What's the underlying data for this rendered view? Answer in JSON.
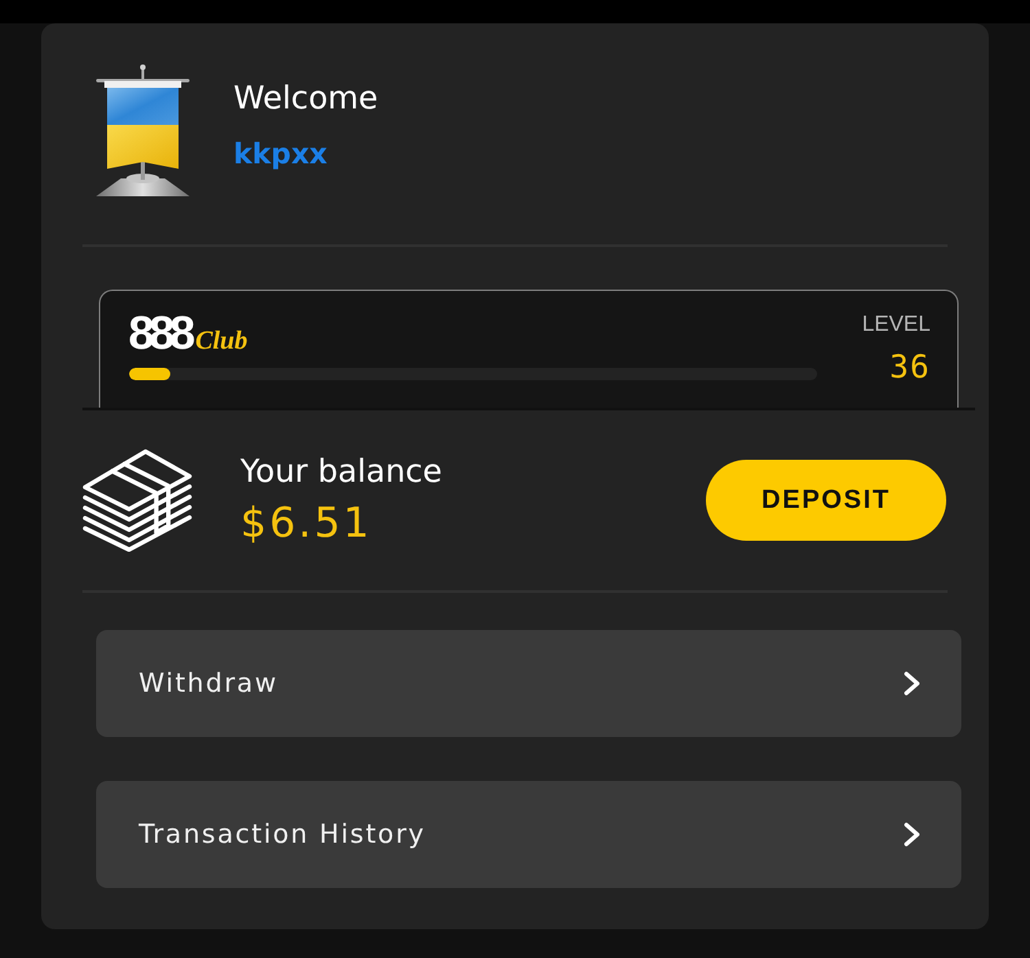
{
  "header": {
    "title": "Welcome",
    "username": "kkpxx"
  },
  "club": {
    "logo": {
      "number": "888",
      "word": "Club"
    },
    "progress": {
      "level": 0.06
    },
    "level_label": "LEVEL",
    "level_value": "36"
  },
  "balance": {
    "label": "Your balance",
    "amount": "$6.51",
    "button": "DEPOSIT"
  },
  "menu": [
    {
      "label": "Withdraw"
    },
    {
      "label": "Transaction History"
    }
  ]
}
